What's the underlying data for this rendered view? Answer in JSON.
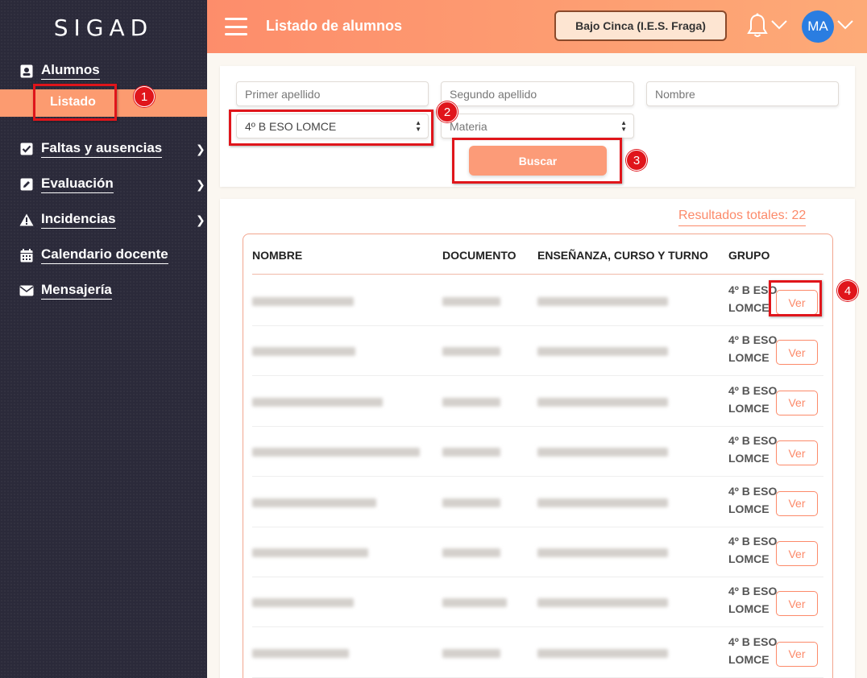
{
  "app": {
    "logo": "SIGAD"
  },
  "sidebar": {
    "items": [
      {
        "label": "Alumnos",
        "icon": "user-id-icon"
      },
      {
        "label": "Faltas y ausencias",
        "icon": "checkbox-icon"
      },
      {
        "label": "Evaluación",
        "icon": "edit-icon"
      },
      {
        "label": "Incidencias",
        "icon": "warning-icon"
      },
      {
        "label": "Calendario docente",
        "icon": "calendar-icon"
      },
      {
        "label": "Mensajería",
        "icon": "envelope-icon"
      }
    ],
    "submenu_active": "Listado"
  },
  "header": {
    "title": "Listado de alumnos",
    "center_button": "Bajo Cinca (I.E.S. Fraga)",
    "avatar_initials": "MA"
  },
  "filters": {
    "primer_apellido_placeholder": "Primer apellido",
    "segundo_apellido_placeholder": "Segundo apellido",
    "nombre_placeholder": "Nombre",
    "grupo_selected": "4º B ESO LOMCE",
    "materia_placeholder": "Materia",
    "search_button": "Buscar"
  },
  "results": {
    "total_label": "Resultados totales: 22",
    "columns": [
      "NOMBRE",
      "DOCUMENTO",
      "ENSEÑANZA, CURSO Y TURNO",
      "GRUPO"
    ],
    "rows": [
      {
        "grupo_line1": "4º B ESO",
        "grupo_line2": "LOMCE",
        "action": "Ver"
      },
      {
        "grupo_line1": "4º B ESO",
        "grupo_line2": "LOMCE",
        "action": "Ver"
      },
      {
        "grupo_line1": "4º B ESO",
        "grupo_line2": "LOMCE",
        "action": "Ver"
      },
      {
        "grupo_line1": "4º B ESO",
        "grupo_line2": "LOMCE",
        "action": "Ver"
      },
      {
        "grupo_line1": "4º B ESO",
        "grupo_line2": "LOMCE",
        "action": "Ver"
      },
      {
        "grupo_line1": "4º B ESO",
        "grupo_line2": "LOMCE",
        "action": "Ver"
      },
      {
        "grupo_line1": "4º B ESO",
        "grupo_line2": "LOMCE",
        "action": "Ver"
      },
      {
        "grupo_line1": "4º B ESO",
        "grupo_line2": "LOMCE",
        "action": "Ver"
      }
    ]
  },
  "annotations": [
    "1",
    "2",
    "3",
    "4"
  ],
  "colors": {
    "accent": "#fc9b78",
    "sidebar": "#2b2a3a",
    "highlight": "#e0151b",
    "avatar": "#2a7de1"
  }
}
